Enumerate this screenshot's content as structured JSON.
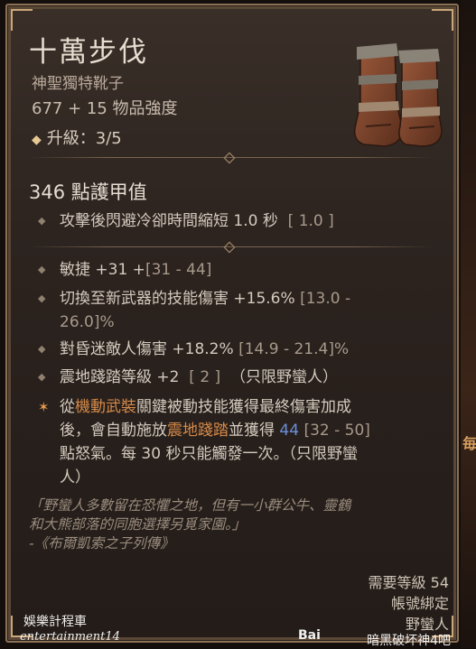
{
  "item": {
    "name": "十萬步伐",
    "type": "神聖獨特靴子",
    "power": "677 + 15 物品強度",
    "upgrade_label": "升級：3/5",
    "armor": "346 點護甲值",
    "implicit": {
      "text": "攻擊後閃避冷卻時間縮短 1.0 秒",
      "range": "[ 1.0 ]"
    },
    "affixes": [
      {
        "text": "敏捷 +31 +",
        "range": "[31 - 44]"
      },
      {
        "text": "切換至新武器的技能傷害 +15.6%",
        "range": "[13.0 -",
        "line2": "26.0]%"
      },
      {
        "text": "對昏迷敵人傷害 +18.2%",
        "range": "[14.9 - 21.4]%"
      },
      {
        "text": "震地踐踏等級 +2",
        "range": "[ 2 ]",
        "suffix": "（只限野蠻人）"
      }
    ],
    "legendary": {
      "l1a": "從",
      "l1b": "機動武裝",
      "l1c": "關鍵被動技能獲得最終傷害加成",
      "l2a": "後，會自動施放",
      "l2b": "震地踐踏",
      "l2c": "並獲得",
      "l2num": "44",
      "l2range": "[32 - 50]",
      "l3": "點怒氣。每 30 秒只能觸發一次。（只限野蠻",
      "l4": "人）"
    },
    "flavor": {
      "line1": "「野蠻人多數留在恐懼之地，但有一小群公牛、靈鶴",
      "line2": "和大熊部落的同胞選擇另覓家園。」",
      "line3": "-《布爾凱索之子列傳》"
    },
    "requirements": {
      "level": "需要等級 54",
      "bound": "帳號綁定",
      "class": "野蠻人",
      "extra": "暗黑破坏神4吧"
    }
  },
  "watermark": {
    "left_line1": "娛樂計程車",
    "left_line2": "entertainment14",
    "baidu": "Bai"
  },
  "side_char": "毎",
  "icons": {
    "bullet": "diamond-bullet-icon",
    "legendary": "star-icon",
    "item": "boots-icon"
  }
}
